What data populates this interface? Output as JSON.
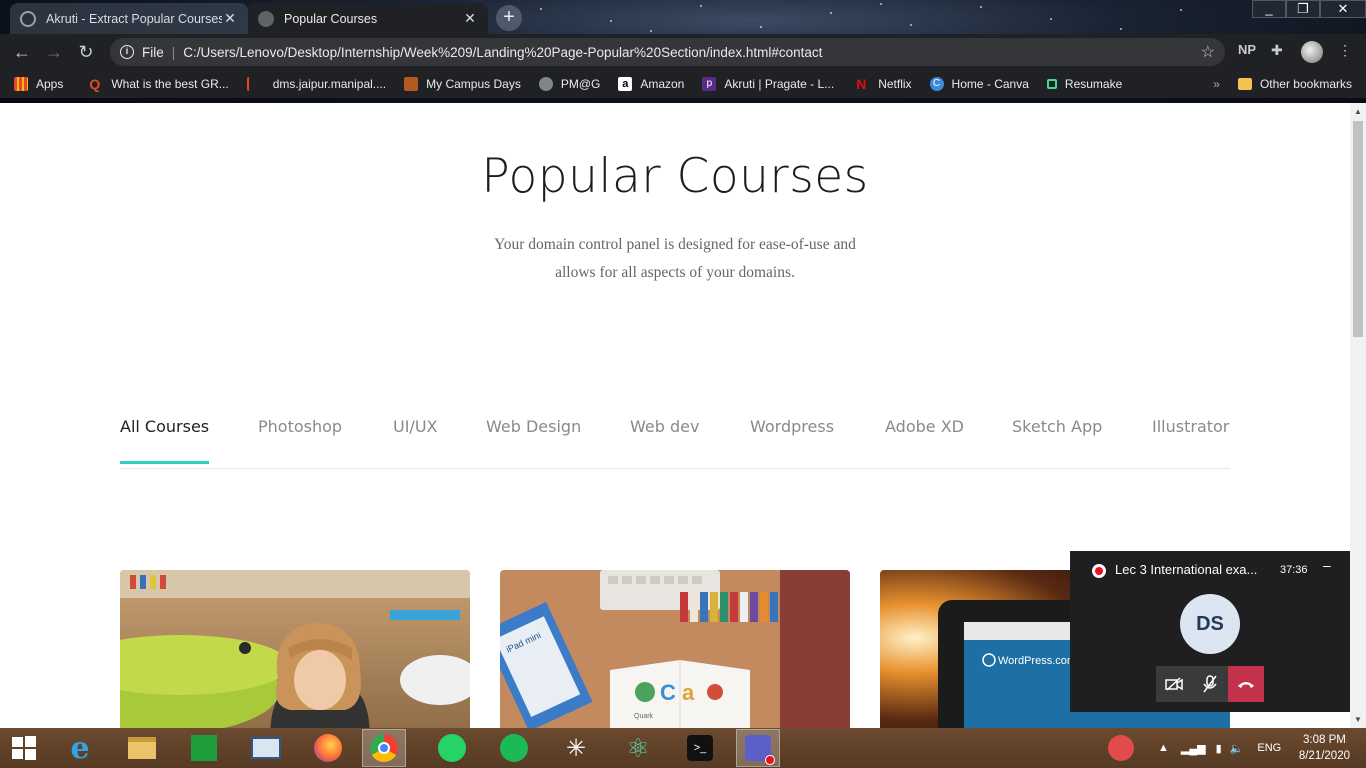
{
  "browser": {
    "tabs": [
      {
        "title": "Akruti - Extract Popular Courses S",
        "active": false
      },
      {
        "title": "Popular Courses",
        "active": true
      }
    ],
    "address": {
      "scheme_label": "File",
      "url": "C:/Users/Lenovo/Desktop/Internship/Week%209/Landing%20Page-Popular%20Section/index.html#contact"
    },
    "profile_initials": "NP",
    "bookmarks": [
      {
        "label": "Apps",
        "icon": "apps-grid-icon"
      },
      {
        "label": "What is the best GR...",
        "icon": "quora-icon"
      },
      {
        "label": "dms.jaipur.manipal....",
        "icon": "page-icon"
      },
      {
        "label": "My Campus Days",
        "icon": "campus-icon"
      },
      {
        "label": "PM@G",
        "icon": "globe-icon"
      },
      {
        "label": "Amazon",
        "icon": "amazon-icon"
      },
      {
        "label": "Akruti | Pragate - L...",
        "icon": "pragate-icon"
      },
      {
        "label": "Netflix",
        "icon": "netflix-icon"
      },
      {
        "label": "Home - Canva",
        "icon": "canva-icon"
      },
      {
        "label": "Resumake",
        "icon": "resumake-icon"
      }
    ],
    "overflow_label": "»",
    "other_bookmarks": "Other bookmarks"
  },
  "page": {
    "title": "Popular Courses",
    "subtitle_line1": "Your domain control panel is designed for ease-of-use and",
    "subtitle_line2": "allows for all aspects of your domains.",
    "course_tabs": [
      "All Courses",
      "Photoshop",
      "UI/UX",
      "Web Design",
      "Web dev",
      "Wordpress",
      "Adobe XD",
      "Sketch App",
      "Illustrator"
    ],
    "active_tab": "All Courses",
    "cards": [
      {
        "image": "girl-playing-photo"
      },
      {
        "image": "desk-books-photo",
        "texts": [
          "iPad mini",
          "Quark",
          "C",
          "a"
        ]
      },
      {
        "image": "laptop-wordpress-photo",
        "texts": [
          "WordPress.com"
        ]
      }
    ],
    "accent_color": "#2fd0c0"
  },
  "teams": {
    "meeting_title": "Lec 3 International exa...",
    "duration": "37:36",
    "minimize": "–",
    "avatar_initials": "DS"
  },
  "taskbar": {
    "language": "ENG",
    "time": "3:08 PM",
    "date": "8/21/2020"
  }
}
